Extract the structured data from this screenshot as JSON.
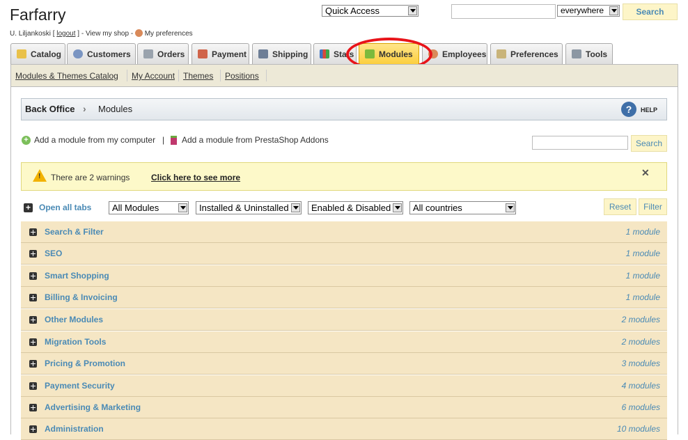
{
  "header": {
    "shop_name": "Farfarry",
    "user_name": "U. Liljankoski",
    "logout_label": "logout",
    "view_shop_label": "View my shop",
    "preferences_label": "My preferences",
    "quick_access_label": "Quick Access",
    "search_scope": "everywhere",
    "search_button": "Search"
  },
  "tabs": [
    {
      "label": "Catalog",
      "icon": "folder-icon"
    },
    {
      "label": "Customers",
      "icon": "user-icon"
    },
    {
      "label": "Orders",
      "icon": "cart-icon"
    },
    {
      "label": "Payment",
      "icon": "card-icon"
    },
    {
      "label": "Shipping",
      "icon": "truck-icon"
    },
    {
      "label": "Stats",
      "icon": "chart-icon"
    },
    {
      "label": "Modules",
      "icon": "puzzle-icon",
      "active": true
    },
    {
      "label": "Employees",
      "icon": "employee-icon"
    },
    {
      "label": "Preferences",
      "icon": "preferences-icon"
    },
    {
      "label": "Tools",
      "icon": "wrench-icon"
    }
  ],
  "subtabs": [
    "Modules & Themes Catalog",
    "My Account",
    "Themes",
    "Positions"
  ],
  "breadcrumb": {
    "root": "Back Office",
    "current": "Modules",
    "help": "HELP"
  },
  "actions": {
    "add_from_computer": "Add a module from my computer",
    "separator": "|",
    "add_from_addons": "Add a module from PrestaShop Addons",
    "search_button": "Search"
  },
  "warning": {
    "text": "There are 2 warnings",
    "link": "Click here to see more",
    "close": "✕"
  },
  "filters": {
    "open_all": "Open all tabs",
    "modules": "All Modules",
    "installed": "Installed & Uninstalled",
    "enabled": "Enabled & Disabled",
    "countries": "All countries",
    "reset": "Reset",
    "filter": "Filter"
  },
  "categories": [
    {
      "name": "Search & Filter",
      "count": "1 module"
    },
    {
      "name": "SEO",
      "count": "1 module"
    },
    {
      "name": "Smart Shopping",
      "count": "1 module"
    },
    {
      "name": "Billing & Invoicing",
      "count": "1 module"
    },
    {
      "name": "Other Modules",
      "count": "2 modules"
    },
    {
      "name": "Migration Tools",
      "count": "2 modules"
    },
    {
      "name": "Pricing & Promotion",
      "count": "3 modules"
    },
    {
      "name": "Payment Security",
      "count": "4 modules"
    },
    {
      "name": "Advertising & Marketing",
      "count": "6 modules"
    },
    {
      "name": "Administration",
      "count": "10 modules"
    }
  ],
  "colors": {
    "accent": "#4a8ab5",
    "active_tab": "#fccf3e",
    "highlight_ring": "#e8141a"
  }
}
